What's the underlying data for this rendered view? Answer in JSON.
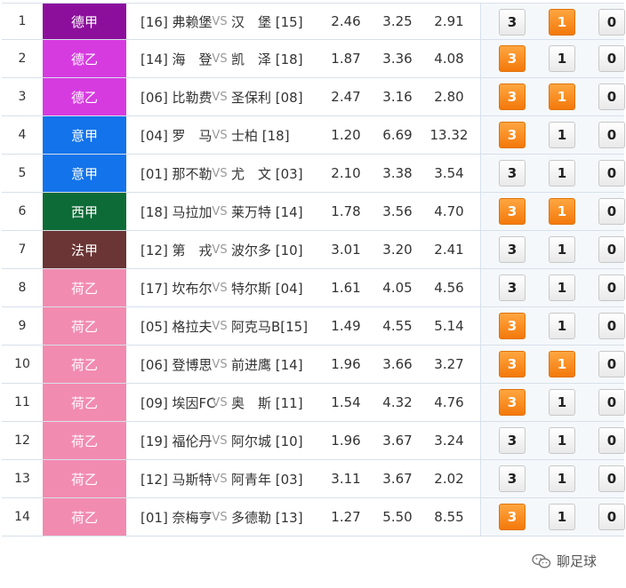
{
  "colors": {
    "德甲": "#8c0f9c",
    "德乙": "#d63be0",
    "意甲": "#1273ea",
    "西甲": "#0d6b37",
    "法甲": "#6a3534",
    "荷乙": "#f28bb0",
    "selected": "#f3790b"
  },
  "vs_label": "VS",
  "rows": [
    {
      "idx": "1",
      "league": "德甲",
      "home": "[16] 弗赖堡",
      "away": "汉　堡 [15]",
      "o1": "2.46",
      "o2": "3.25",
      "o3": "2.91",
      "p3": false,
      "p1": true,
      "p0": false
    },
    {
      "idx": "2",
      "league": "德乙",
      "home": "[14] 海　登",
      "away": "凯　泽 [18]",
      "o1": "1.87",
      "o2": "3.36",
      "o3": "4.08",
      "p3": true,
      "p1": false,
      "p0": false
    },
    {
      "idx": "3",
      "league": "德乙",
      "home": "[06] 比勒费",
      "away": "圣保利 [08]",
      "o1": "2.47",
      "o2": "3.16",
      "o3": "2.80",
      "p3": true,
      "p1": true,
      "p0": false
    },
    {
      "idx": "4",
      "league": "意甲",
      "home": "[04] 罗　马",
      "away": "士柏 [18]",
      "o1": "1.20",
      "o2": "6.69",
      "o3": "13.32",
      "p3": true,
      "p1": false,
      "p0": false
    },
    {
      "idx": "5",
      "league": "意甲",
      "home": "[01] 那不勒",
      "away": "尤　文 [03]",
      "o1": "2.10",
      "o2": "3.38",
      "o3": "3.54",
      "p3": false,
      "p1": false,
      "p0": false
    },
    {
      "idx": "6",
      "league": "西甲",
      "home": "[18] 马拉加",
      "away": "莱万特 [14]",
      "o1": "1.78",
      "o2": "3.56",
      "o3": "4.70",
      "p3": true,
      "p1": true,
      "p0": false
    },
    {
      "idx": "7",
      "league": "法甲",
      "home": "[12] 第　戎",
      "away": "波尔多 [10]",
      "o1": "3.01",
      "o2": "3.20",
      "o3": "2.41",
      "p3": false,
      "p1": false,
      "p0": false
    },
    {
      "idx": "8",
      "league": "荷乙",
      "home": "[17] 坎布尔",
      "away": "特尔斯 [04]",
      "o1": "1.61",
      "o2": "4.05",
      "o3": "4.56",
      "p3": false,
      "p1": false,
      "p0": false
    },
    {
      "idx": "9",
      "league": "荷乙",
      "home": "[05] 格拉夫",
      "away": "阿克马B[15]",
      "o1": "1.49",
      "o2": "4.55",
      "o3": "5.14",
      "p3": true,
      "p1": false,
      "p0": false
    },
    {
      "idx": "10",
      "league": "荷乙",
      "home": "[06] 登博思",
      "away": "前进鹰 [14]",
      "o1": "1.96",
      "o2": "3.66",
      "o3": "3.27",
      "p3": true,
      "p1": true,
      "p0": false
    },
    {
      "idx": "11",
      "league": "荷乙",
      "home": "[09] 埃因FC",
      "away": "奥　斯 [11]",
      "o1": "1.54",
      "o2": "4.32",
      "o3": "4.76",
      "p3": true,
      "p1": false,
      "p0": false
    },
    {
      "idx": "12",
      "league": "荷乙",
      "home": "[19] 福伦丹",
      "away": "阿尔城 [10]",
      "o1": "1.96",
      "o2": "3.67",
      "o3": "3.24",
      "p3": false,
      "p1": false,
      "p0": false
    },
    {
      "idx": "13",
      "league": "荷乙",
      "home": "[12] 马斯特",
      "away": "阿青年 [03]",
      "o1": "3.11",
      "o2": "3.67",
      "o3": "2.02",
      "p3": false,
      "p1": false,
      "p0": false
    },
    {
      "idx": "14",
      "league": "荷乙",
      "home": "[01] 奈梅亨",
      "away": "多德勒 [13]",
      "o1": "1.27",
      "o2": "5.50",
      "o3": "8.55",
      "p3": true,
      "p1": false,
      "p0": false
    }
  ],
  "pick_labels": {
    "win": "3",
    "draw": "1",
    "loss": "0"
  },
  "watermark": {
    "icon": "wechat-icon",
    "text": "聊足球"
  }
}
